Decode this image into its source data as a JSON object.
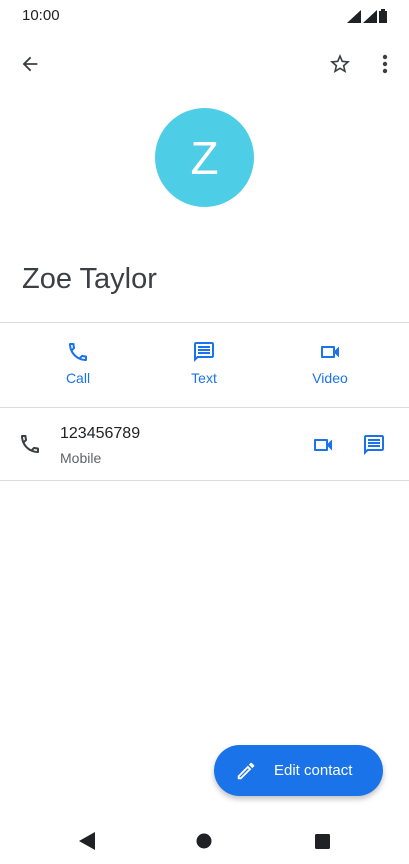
{
  "status_bar": {
    "time": "10:00"
  },
  "contact": {
    "avatar_letter": "Z",
    "avatar_color": "#4ecde6",
    "name": "Zoe Taylor"
  },
  "actions": [
    {
      "label": "Call",
      "icon": "phone-icon"
    },
    {
      "label": "Text",
      "icon": "message-icon"
    },
    {
      "label": "Video",
      "icon": "video-icon"
    }
  ],
  "phone": {
    "number": "123456789",
    "type": "Mobile"
  },
  "fab": {
    "label": "Edit contact",
    "icon": "pencil-icon"
  },
  "colors": {
    "accent": "#1a73e8",
    "avatar": "#4ecde6"
  }
}
